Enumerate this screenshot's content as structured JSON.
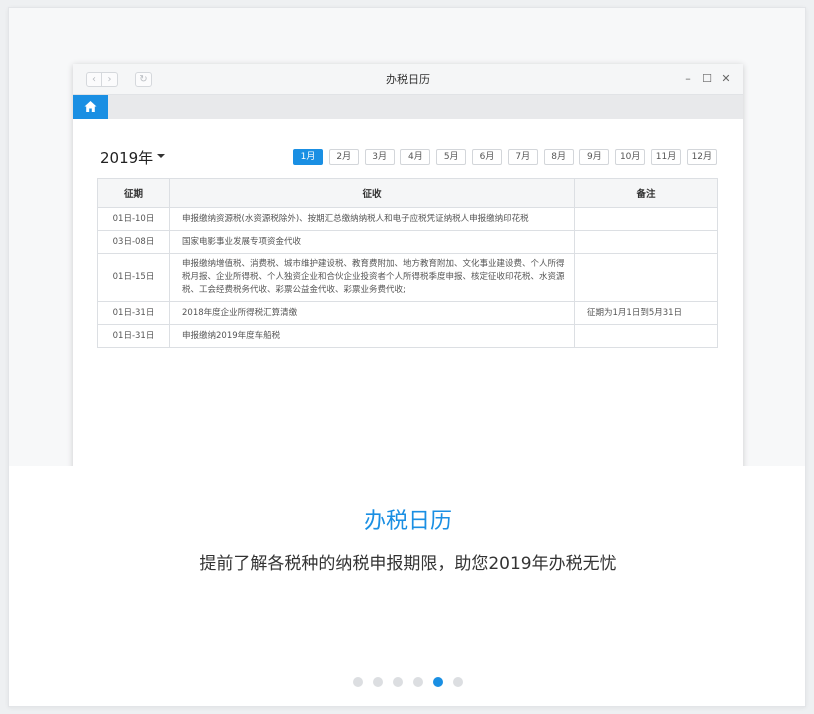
{
  "window": {
    "title": "办税日历",
    "nav_back": "‹",
    "nav_forward": "›",
    "refresh": "↻",
    "minimize": "–",
    "maximize": "☐",
    "close": "✕"
  },
  "tab": {
    "icon": "home-icon"
  },
  "calendar": {
    "year": "2019年",
    "months": [
      "1月",
      "2月",
      "3月",
      "4月",
      "5月",
      "6月",
      "7月",
      "8月",
      "9月",
      "10月",
      "11月",
      "12月"
    ],
    "active_month": "1月",
    "table": {
      "headers": [
        "征期",
        "征收",
        "备注"
      ],
      "rows": [
        {
          "period": "01日-10日",
          "collection": "申报缴纳资源税(水资源税除外)、按期汇总缴纳纳税人和电子应税凭证纳税人申报缴纳印花税",
          "note": ""
        },
        {
          "period": "03日-08日",
          "collection": "国家电影事业发展专项资金代收",
          "note": ""
        },
        {
          "period": "01日-15日",
          "collection": "申报缴纳增值税、消费税、城市维护建设税、教育费附加、地方教育附加、文化事业建设费、个人所得税月报、企业所得税、个人独资企业和合伙企业投资者个人所得税季度申报、核定征收印花税、水资源税、工会经费税务代收、彩票公益金代收、彩票业务费代收;",
          "note": ""
        },
        {
          "period": "01日-31日",
          "collection": "2018年度企业所得税汇算清缴",
          "note": "征期为1月1日到5月31日"
        },
        {
          "period": "01日-31日",
          "collection": "申报缴纳2019年度车船税",
          "note": ""
        }
      ]
    }
  },
  "caption": {
    "title": "办税日历",
    "subtitle": "提前了解各税种的纳税申报期限，助您2019年办税无忧"
  },
  "carousel": {
    "count": 6,
    "active_index": 4
  },
  "colors": {
    "accent": "#1a8fe3",
    "dot_inactive": "#dcdee1"
  }
}
